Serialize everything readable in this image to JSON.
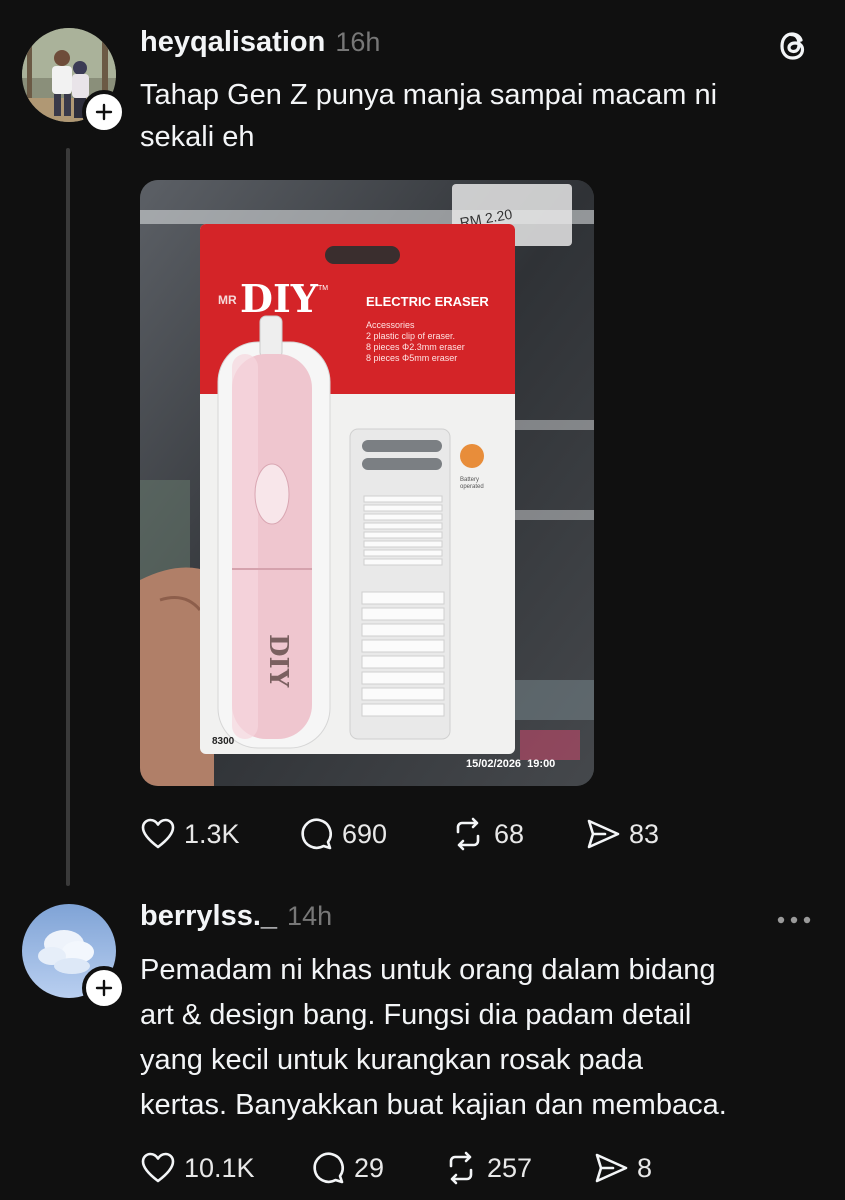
{
  "app": {
    "logo_icon": "threads-logo-icon"
  },
  "post1": {
    "username": "heyqalisation",
    "time": "16h",
    "text_line1": "Tahap Gen Z punya manja sampai macam ni",
    "text_line2": "sekali eh",
    "image": {
      "brand_small": "MR",
      "brand": "DIY",
      "tm": "TM",
      "product_title": "ELECTRIC ERASER",
      "accessories_line1": "Accessories",
      "accessories_line2": "2 plastic clip of eraser.",
      "accessories_line3": "8 pieces Φ2.3mm eraser",
      "accessories_line4": "8 pieces Φ5mm eraser",
      "battery_line1": "Battery",
      "battery_line2": "operated",
      "price_tag": "RM 2.20",
      "code": "8300",
      "timestamp": "15/02/2026  19:00"
    },
    "likes": "1.3K",
    "comments": "690",
    "reposts": "68",
    "shares": "83"
  },
  "post2": {
    "username": "berrylss._",
    "time": "14h",
    "text_lines": [
      "Pemadam ni khas untuk orang dalam bidang",
      "art & design bang. Fungsi dia padam detail",
      "yang kecil untuk kurangkan rosak pada",
      "kertas. Banyakkan buat kajian dan membaca."
    ],
    "likes": "10.1K",
    "comments": "29",
    "reposts": "257",
    "shares": "8"
  }
}
